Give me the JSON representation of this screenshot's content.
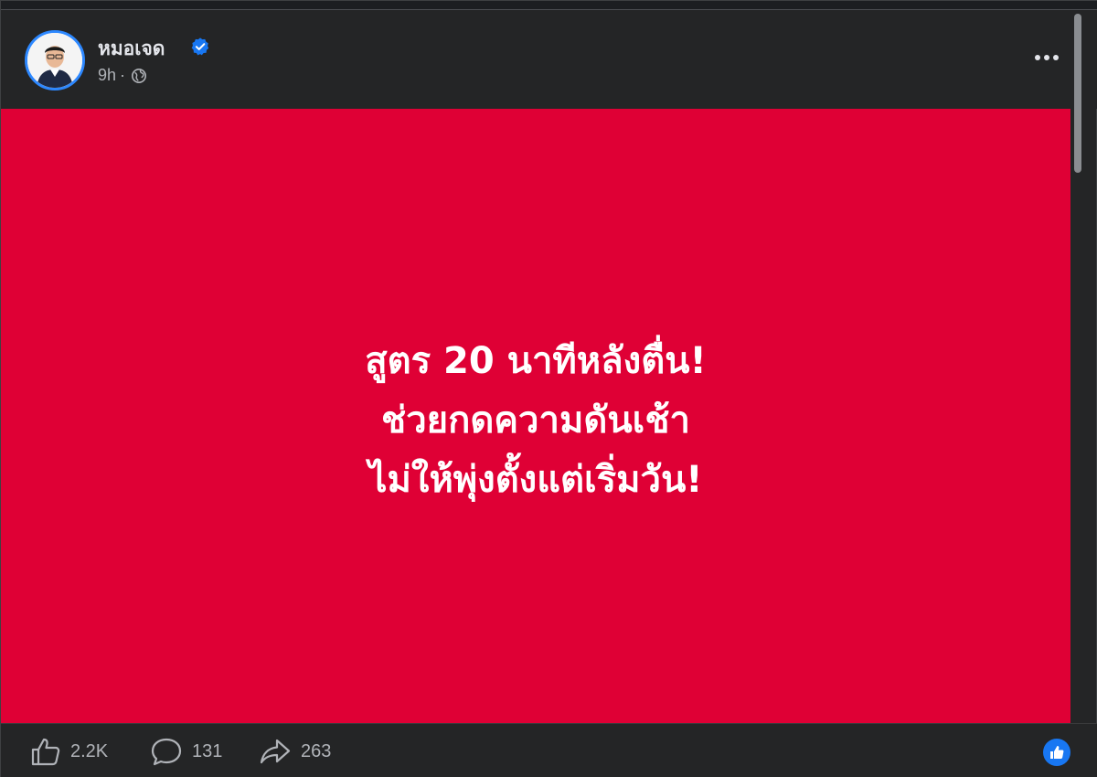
{
  "post": {
    "author": "หมอเจด",
    "time": "9h",
    "separator": "·",
    "privacy_icon": "globe-icon",
    "verified_icon": "verified-badge-icon",
    "background_color": "#df0035",
    "lines": [
      "สูตร 20 นาทีหลังตื่น!",
      "ช่วยกดความดันเช้า",
      "ไม่ให้พุ่งตั้งแต่เริ่มวัน!"
    ]
  },
  "stats": {
    "likes": "2.2K",
    "comments": "131",
    "shares": "263"
  },
  "icons": {
    "more": "more-options-icon",
    "like": "thumbs-up-icon",
    "comment": "comment-bubble-icon",
    "share": "share-arrow-icon",
    "reaction": "like-reaction-icon"
  },
  "colors": {
    "accent": "#1877f2",
    "page_bg": "#242526",
    "text_secondary": "#b0b3b8"
  }
}
